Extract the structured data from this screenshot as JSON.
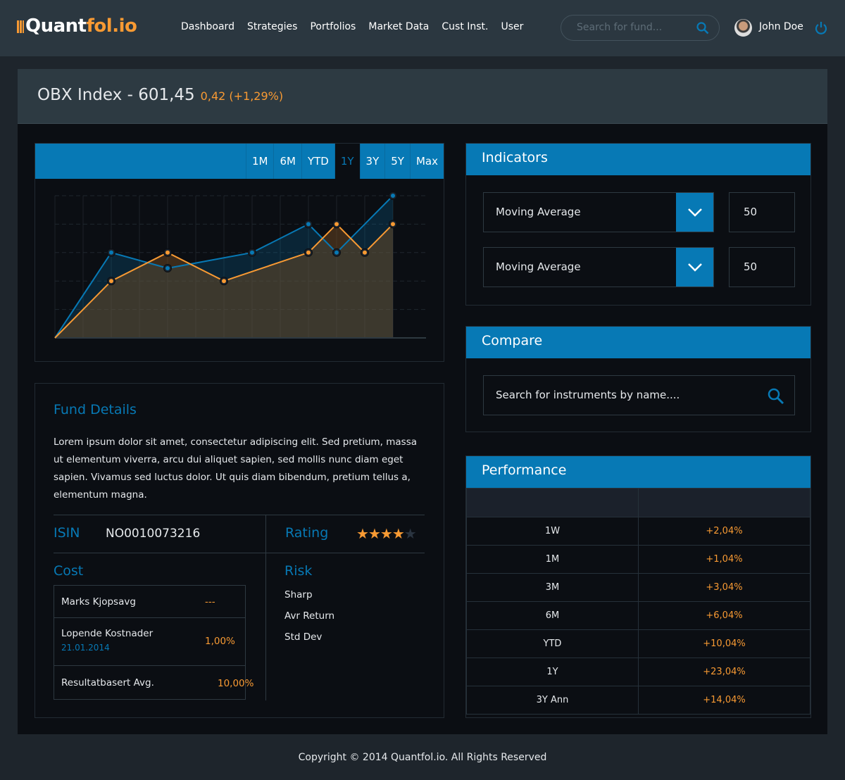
{
  "brand": {
    "logo_white": "Quant",
    "logo_orange": "fol.io"
  },
  "nav": [
    "Dashboard",
    "Strategies",
    "Portfolios",
    "Market Data",
    "Cust Inst.",
    "User"
  ],
  "search": {
    "placeholder": "Search for fund..."
  },
  "user": {
    "name": "John Doe"
  },
  "index": {
    "title": "OBX Index - 601,45",
    "change": "0,42 (+1,29%)"
  },
  "chart_tabs": [
    "1M",
    "6M",
    "YTD",
    "1Y",
    "3Y",
    "5Y",
    "Max"
  ],
  "chart_active": "1Y",
  "chart_data": {
    "type": "area",
    "x": [
      0,
      1,
      2,
      3,
      4,
      5,
      6,
      7,
      8,
      9,
      10,
      11,
      12
    ],
    "ylim": [
      0,
      5
    ],
    "grid": true,
    "series": [
      {
        "name": "blue",
        "color": "#0779b5",
        "points": [
          [
            0,
            0
          ],
          [
            2,
            3
          ],
          [
            4,
            2.45
          ],
          [
            7,
            3
          ],
          [
            9,
            4
          ],
          [
            10,
            3
          ],
          [
            12,
            5
          ]
        ]
      },
      {
        "name": "orange",
        "color": "#f89a33",
        "points": [
          [
            0,
            0
          ],
          [
            2,
            2
          ],
          [
            4,
            3
          ],
          [
            6,
            2
          ],
          [
            9,
            3
          ],
          [
            10,
            4
          ],
          [
            11,
            3
          ],
          [
            12,
            4
          ]
        ]
      }
    ]
  },
  "indicators": {
    "title": "Indicators",
    "rows": [
      {
        "type": "Moving Average",
        "value": "50"
      },
      {
        "type": "Moving Average",
        "value": "50"
      }
    ]
  },
  "compare": {
    "title": "Compare",
    "placeholder": "Search for instruments by name...."
  },
  "performance": {
    "title": "Performance",
    "rows": [
      [
        "1W",
        "+2,04%"
      ],
      [
        "1M",
        "+1,04%"
      ],
      [
        "3M",
        "+3,04%"
      ],
      [
        "6M",
        "+6,04%"
      ],
      [
        "YTD",
        "+10,04%"
      ],
      [
        "1Y",
        "+23,04%"
      ],
      [
        "3Y Ann",
        "+14,04%"
      ]
    ]
  },
  "fund": {
    "title": "Fund Details",
    "description": "Lorem ipsum dolor sit amet, consectetur adipiscing elit. Sed pretium, massa ut elementum viverra, arcu dui aliquet sapien, sed mollis nunc diam eget sapien. Vivamus sed luctus dolor. Ut quis diam bibendum, pretium tellus a, elementum magna.",
    "isin_label": "ISIN",
    "isin": "NO0010073216",
    "rating_label": "Rating",
    "rating": 4,
    "rating_max": 5,
    "cost_label": "Cost",
    "costs": [
      {
        "name": "Marks Kjopsavg",
        "value": "---"
      },
      {
        "name": "Lopende Kostnader",
        "date": "21.01.2014",
        "value": "1,00%"
      },
      {
        "name": "Resultatbasert Avg.",
        "value": "10,00%"
      }
    ],
    "risk_label": "Risk",
    "risk": [
      "Sharp",
      "Avr Return",
      "Std Dev"
    ]
  },
  "footer": "Copyright © 2014 Quantfol.io. All Rights Reserved"
}
